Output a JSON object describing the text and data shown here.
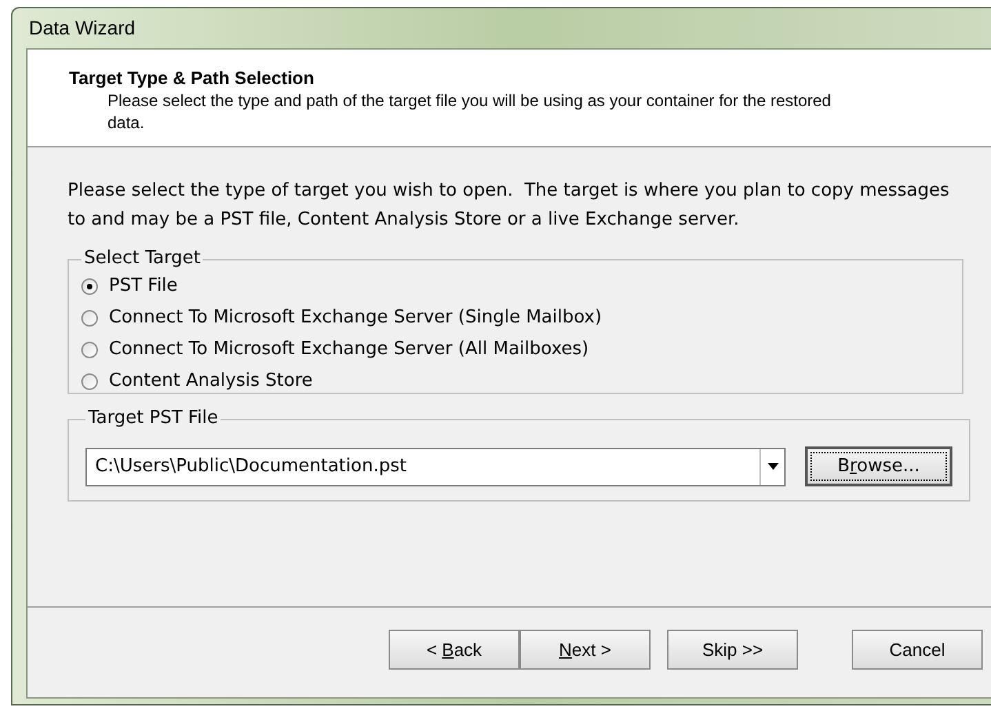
{
  "window": {
    "title": "Data Wizard"
  },
  "header": {
    "title": "Target Type & Path Selection",
    "subtitle": "Please select the type and path of the target file you will be using as your container for the restored data."
  },
  "instructions": "Please select the type of target you wish to open.  The target is where you plan to copy messages to and may be a PST file, Content Analysis Store or a live Exchange server.",
  "select_target": {
    "legend": "Select Target",
    "options": [
      {
        "label": "PST File",
        "selected": true
      },
      {
        "label": "Connect To Microsoft Exchange Server (Single Mailbox)",
        "selected": false
      },
      {
        "label": "Connect To Microsoft Exchange Server (All Mailboxes)",
        "selected": false
      },
      {
        "label": "Content Analysis Store",
        "selected": false
      }
    ]
  },
  "target_file": {
    "legend": "Target PST File",
    "value": "C:\\Users\\Public\\Documentation.pst",
    "browse": {
      "before": "B",
      "key": "r",
      "after": "owse..."
    }
  },
  "buttons": [
    {
      "before": "< ",
      "key": "B",
      "after": "ack",
      "kind": "back"
    },
    {
      "key": "N",
      "after": "ext >",
      "kind": "next"
    },
    {
      "before": "Skip >>",
      "kind": "skip"
    },
    {
      "before": "Cancel",
      "kind": "cancel"
    }
  ]
}
